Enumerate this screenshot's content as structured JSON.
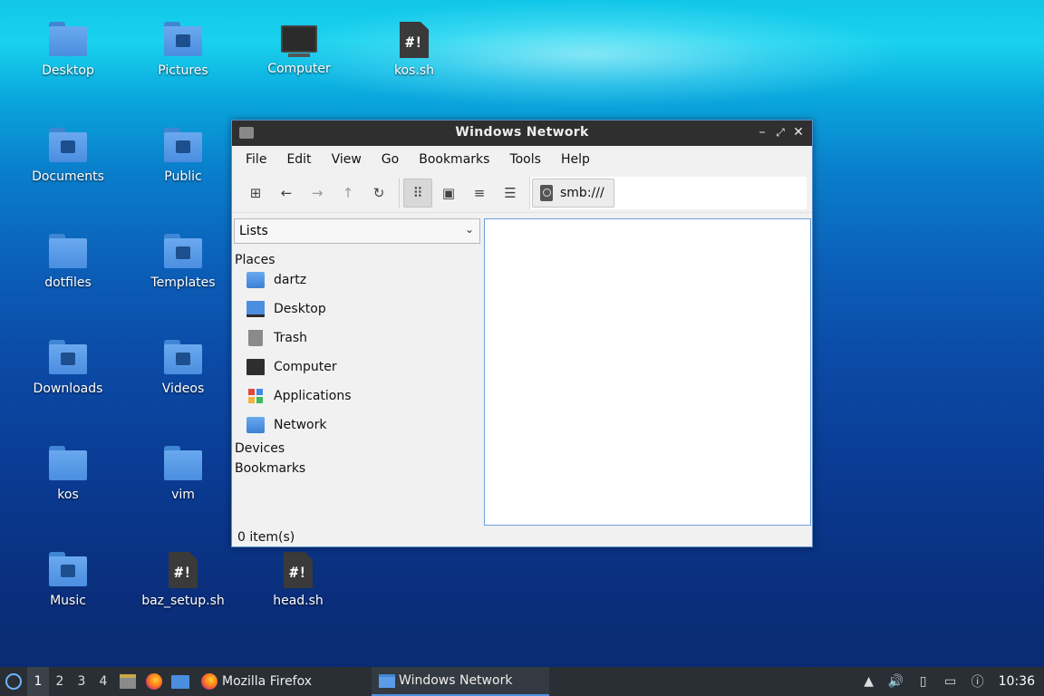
{
  "desktop": {
    "icons": [
      {
        "label": "Desktop",
        "icon": "folder"
      },
      {
        "label": "Pictures",
        "icon": "folder-pictures"
      },
      {
        "label": "Computer",
        "icon": "computer"
      },
      {
        "label": "kos.sh",
        "icon": "script-file",
        "glyph": "#!"
      },
      {
        "label": "Documents",
        "icon": "folder-documents"
      },
      {
        "label": "Public",
        "icon": "folder-public"
      },
      {
        "label": "dotfiles",
        "icon": "folder"
      },
      {
        "label": "Templates",
        "icon": "folder-templates"
      },
      {
        "label": "Downloads",
        "icon": "folder-downloads"
      },
      {
        "label": "Videos",
        "icon": "folder-videos"
      },
      {
        "label": "kos",
        "icon": "folder"
      },
      {
        "label": "vim",
        "icon": "folder"
      },
      {
        "label": "Music",
        "icon": "folder-music"
      },
      {
        "label": "baz_setup.sh",
        "icon": "script-file",
        "glyph": "#!"
      },
      {
        "label": "head.sh",
        "icon": "script-file",
        "glyph": "#!"
      }
    ]
  },
  "window": {
    "title": "Windows Network",
    "controls": {
      "minimize": "–",
      "maximize": "⤢",
      "close": "✕"
    },
    "menu": [
      "File",
      "Edit",
      "View",
      "Go",
      "Bookmarks",
      "Tools",
      "Help"
    ],
    "toolbar": {
      "new_tab": "⊞",
      "back": "←",
      "forward": "→",
      "up": "↑",
      "reload": "↻",
      "view_icons": "⠿",
      "view_thumbnails": "▣",
      "view_compact": "≡",
      "view_detailed": "☰"
    },
    "location": "smb:///",
    "sidebar": {
      "mode": "Lists",
      "places_heading": "Places",
      "places": [
        {
          "label": "dartz",
          "icon": "home-folder"
        },
        {
          "label": "Desktop",
          "icon": "desktop"
        },
        {
          "label": "Trash",
          "icon": "trash"
        },
        {
          "label": "Computer",
          "icon": "computer"
        },
        {
          "label": "Applications",
          "icon": "applications"
        },
        {
          "label": "Network",
          "icon": "network-folder"
        }
      ],
      "devices_heading": "Devices",
      "bookmarks_heading": "Bookmarks"
    },
    "status": "0 item(s)"
  },
  "taskbar": {
    "workspaces": [
      "1",
      "2",
      "3",
      "4"
    ],
    "current_workspace": "1",
    "tasks": [
      {
        "label": "Mozilla Firefox",
        "icon": "firefox"
      },
      {
        "label": "Windows Network",
        "icon": "folder",
        "active": true
      }
    ],
    "clock": "10:36"
  },
  "colors": {
    "accent": "#4d8fe0",
    "titlebar": "#2f2f2f",
    "taskbar": "#2a2f35",
    "folder": "#5b9be8"
  }
}
